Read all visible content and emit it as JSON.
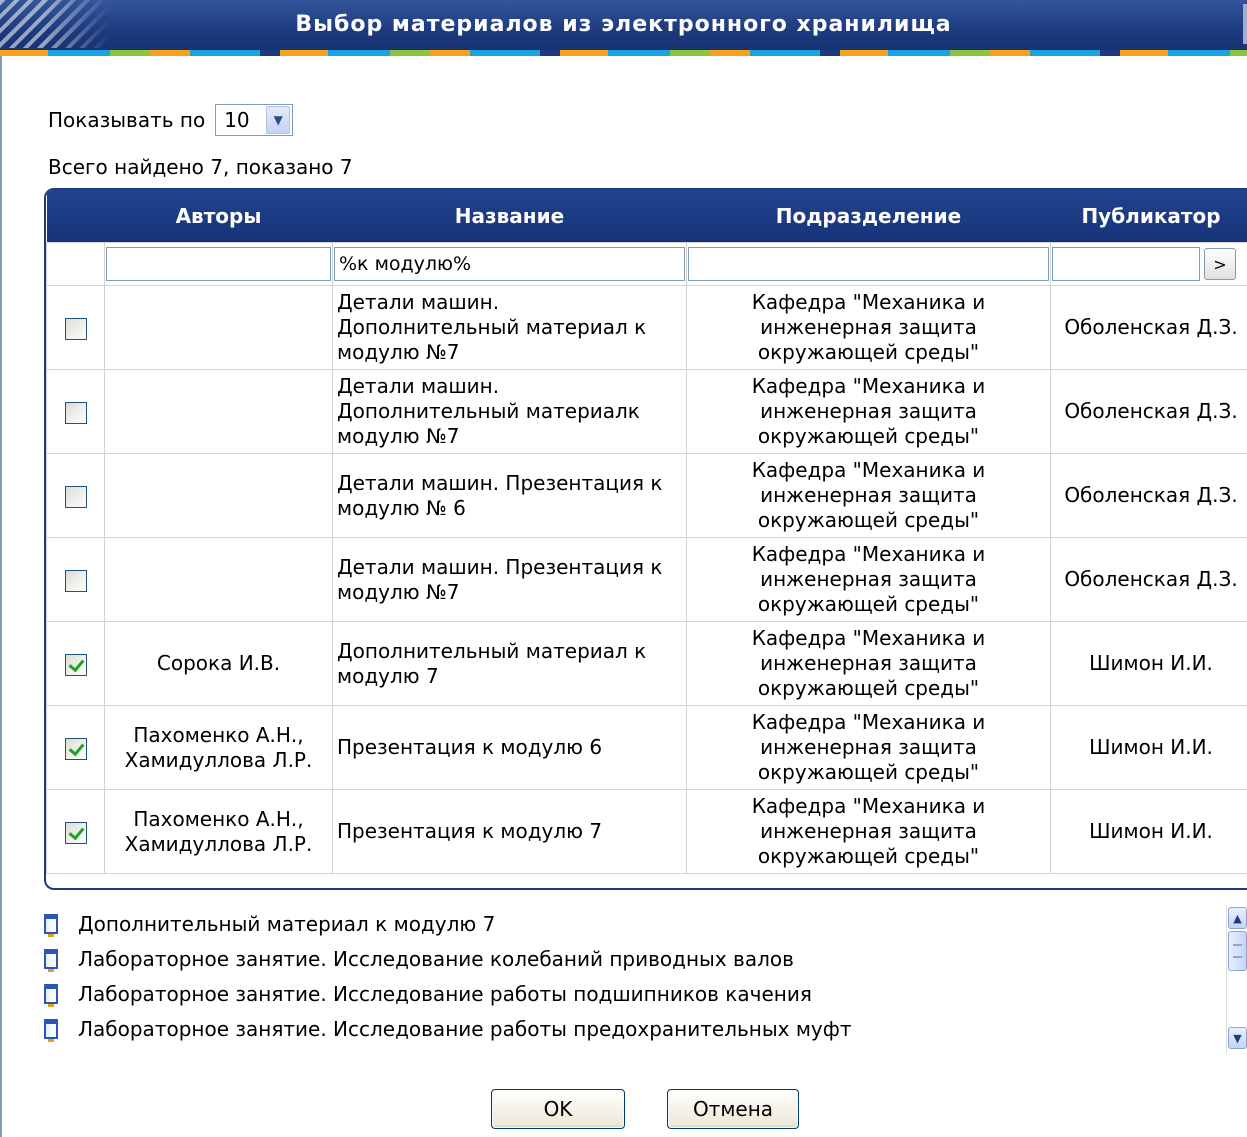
{
  "window": {
    "title": "Выбор материалов из электронного хранилища"
  },
  "controls": {
    "page_size_label": "Показывать по",
    "page_size_value": "10",
    "found_text": "Всего найдено 7, показано 7"
  },
  "table": {
    "headers": [
      "Авторы",
      "Название",
      "Подразделение",
      "Публикатор"
    ],
    "filters": {
      "authors": "",
      "title": "%к модулю%",
      "department": "",
      "publisher": "",
      "go_label": ">"
    },
    "rows": [
      {
        "checked": false,
        "authors": "",
        "title": "Детали машин. Дополнительный материал к модулю №7",
        "department": "Кафедра \"Механика и инженерная защита окружающей среды\"",
        "publisher": "Оболенская Д.З."
      },
      {
        "checked": false,
        "authors": "",
        "title": "Детали машин. Дополнительный материалк модулю №7",
        "department": "Кафедра \"Механика и инженерная защита окружающей среды\"",
        "publisher": "Оболенская Д.З."
      },
      {
        "checked": false,
        "authors": "",
        "title": "Детали машин. Презентация к модулю № 6",
        "department": "Кафедра \"Механика и инженерная защита окружающей среды\"",
        "publisher": "Оболенская Д.З."
      },
      {
        "checked": false,
        "authors": "",
        "title": "Детали машин. Презентация к модулю №7",
        "department": "Кафедра \"Механика и инженерная защита окружающей среды\"",
        "publisher": "Оболенская Д.З."
      },
      {
        "checked": true,
        "authors": "Сорока И.В.",
        "title": "Дополнительный материал к модулю 7",
        "department": "Кафедра \"Механика и инженерная защита окружающей среды\"",
        "publisher": "Шимон И.И."
      },
      {
        "checked": true,
        "authors": "Пахоменко А.Н., Хамидуллова Л.Р.",
        "title": "Презентация к модулю 6",
        "department": "Кафедра \"Механика и инженерная защита окружающей среды\"",
        "publisher": "Шимон И.И."
      },
      {
        "checked": true,
        "authors": "Пахоменко А.Н., Хамидуллова Л.Р.",
        "title": "Презентация к модулю 7",
        "department": "Кафедра \"Механика и инженерная защита окружающей среды\"",
        "publisher": "Шимон И.И."
      }
    ]
  },
  "selected_list": {
    "icon": "document-icon",
    "items": [
      "Дополнительный материал к модулю 7",
      "Лабораторное занятие. Исследование колебаний приводных валов",
      "Лабораторное занятие. Исследование работы подшипников качения",
      "Лабораторное занятие. Исследование работы предохранительных муфт"
    ]
  },
  "buttons": {
    "ok": "OK",
    "cancel": "Отмена"
  }
}
